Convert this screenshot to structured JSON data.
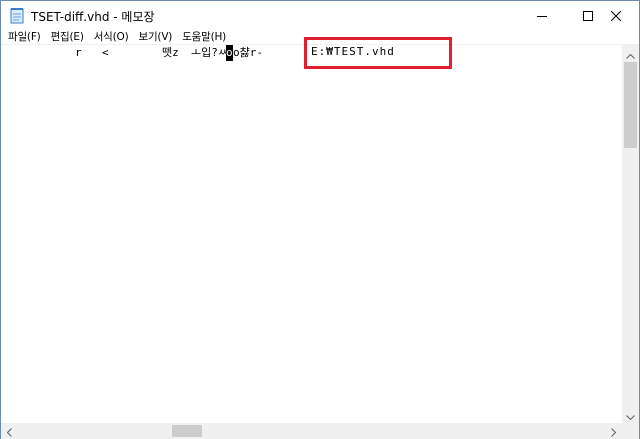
{
  "window": {
    "title": "TSET-diff.vhd - 메모장",
    "icon": "notepad-icon",
    "buttons": {
      "minimize": "minimize-icon",
      "maximize": "maximize-icon",
      "close": "close-icon"
    }
  },
  "menu": {
    "items": [
      {
        "label": "파일(F)"
      },
      {
        "label": "편집(E)"
      },
      {
        "label": "서식(O)"
      },
      {
        "label": "보기(V)"
      },
      {
        "label": "도움말(H)"
      }
    ]
  },
  "editor": {
    "line1": {
      "seg1": "r",
      "seg2": "<",
      "seg3": "뗏z",
      "seg4": "ㅗ입?ㅆ",
      "seg5": "o",
      "seg6": "o챯r-"
    },
    "highlighted_path": "E:₩TEST.vhd"
  },
  "annotation": {
    "color": "#e0202e"
  },
  "scrollbars": {
    "up_arrow": "chevron-up-icon",
    "down_arrow": "chevron-down-icon",
    "left_arrow": "chevron-left-icon",
    "right_arrow": "chevron-right-icon"
  }
}
